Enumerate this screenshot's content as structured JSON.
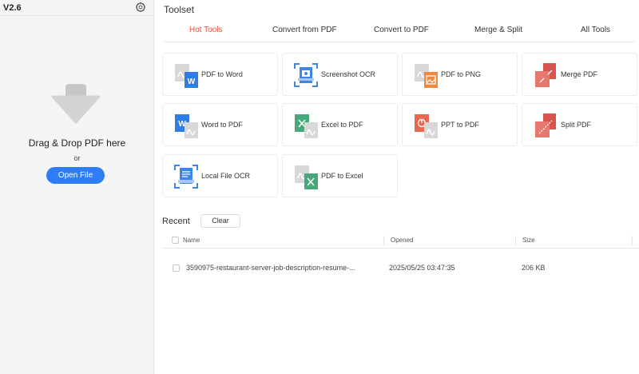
{
  "app": {
    "version": "V2.6"
  },
  "left_panel": {
    "drop_text": "Drag & Drop PDF here",
    "or_text": "or",
    "open_button": "Open File"
  },
  "main": {
    "title": "Toolset",
    "tabs": [
      {
        "label": "Hot Tools",
        "active": true
      },
      {
        "label": "Convert from PDF",
        "active": false
      },
      {
        "label": "Convert to PDF",
        "active": false
      },
      {
        "label": "Merge & Split",
        "active": false
      },
      {
        "label": "All Tools",
        "active": false
      }
    ],
    "tools": [
      {
        "label": "PDF to Word",
        "icon": "pdf-to-word-icon"
      },
      {
        "label": "Screenshot OCR",
        "icon": "screenshot-ocr-icon"
      },
      {
        "label": "PDF to PNG",
        "icon": "pdf-to-png-icon"
      },
      {
        "label": "Merge PDF",
        "icon": "merge-pdf-icon"
      },
      {
        "label": "Word to PDF",
        "icon": "word-to-pdf-icon"
      },
      {
        "label": "Excel to PDF",
        "icon": "excel-to-pdf-icon"
      },
      {
        "label": "PPT to PDF",
        "icon": "ppt-to-pdf-icon"
      },
      {
        "label": "Split PDF",
        "icon": "split-pdf-icon"
      },
      {
        "label": "Local File OCR",
        "icon": "local-file-ocr-icon"
      },
      {
        "label": "PDF to Excel",
        "icon": "pdf-to-excel-icon"
      }
    ],
    "recent": {
      "title": "Recent",
      "clear_button": "Clear",
      "columns": [
        "Name",
        "Opened",
        "Size"
      ],
      "rows": [
        {
          "name": "3590975-restaurant-server-job-description-resume-...",
          "opened": "2025/05/25 03:47:35",
          "size": "206 KB"
        }
      ]
    }
  },
  "colors": {
    "accent_blue": "#2e7cf6",
    "active_tab": "#e8503a",
    "word_blue": "#2f7ce6",
    "excel_green": "#47a97a",
    "ppt_orange": "#e8674f",
    "png_orange": "#ef8a3e",
    "merge_red": "#d9534f"
  }
}
